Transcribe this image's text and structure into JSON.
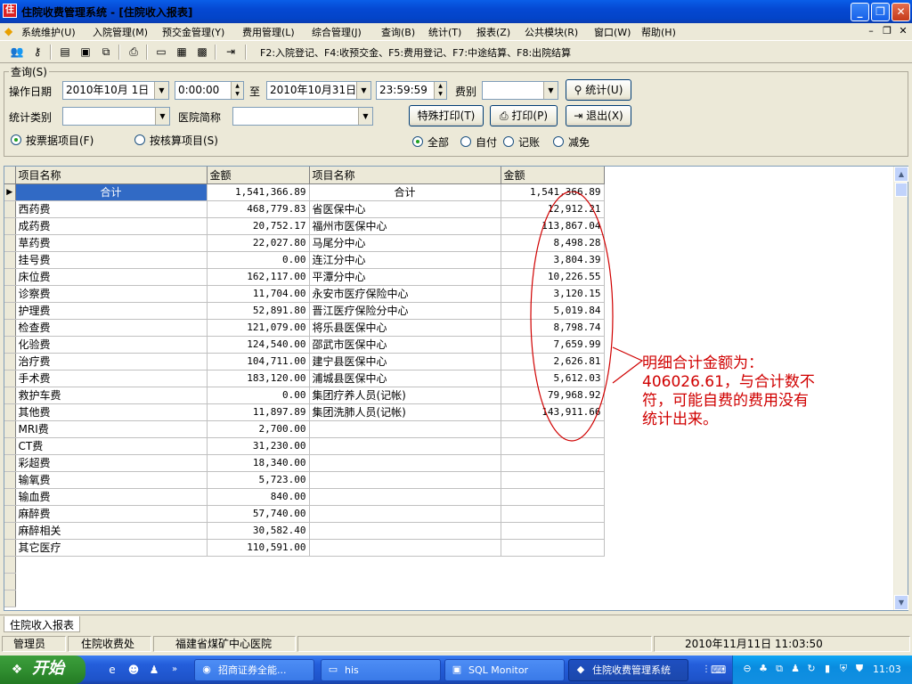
{
  "window": {
    "title": "住院收费管理系统 - [住院收入报表]",
    "app_icon": "住"
  },
  "menu": [
    "系统维护(U)",
    "入院管理(M)",
    "预交金管理(Y)",
    "费用管理(L)",
    "综合管理(J)",
    "查询(B)",
    "统计(T)",
    "报表(Z)",
    "公共模块(R)",
    "窗口(W)",
    "帮助(H)"
  ],
  "toolbar": {
    "hint": "F2:入院登记、F4:收预交金、F5:费用登记、F7:中途结算、F8:出院结算"
  },
  "query": {
    "legend": "查询(S)",
    "date_label": "操作日期",
    "date_from": "2010年10月 1日",
    "time_from": "0:00:00",
    "to_label": "至",
    "date_to": "2010年10月31日",
    "time_to": "23:59:59",
    "fee_type_label": "费别",
    "fee_type_value": "",
    "stat_button": "统计(U)",
    "stat_category_label": "统计类别",
    "stat_category_value": "",
    "hospital_label": "医院简称",
    "hospital_value": "",
    "special_print_button": "特殊打印(T)",
    "print_button": "打印(P)",
    "exit_button": "退出(X)",
    "by_receipt": "按票据项目(F)",
    "by_accounting": "按核算项目(S)",
    "opt_all": "全部",
    "opt_self": "自付",
    "opt_account": "记账",
    "opt_waive": "减免"
  },
  "grid": {
    "columns": [
      "项目名称",
      "金额",
      "项目名称",
      "金额"
    ],
    "rows": [
      [
        "合计",
        "1,541,366.89",
        "合计",
        "1,541,366.89"
      ],
      [
        "西药费",
        "468,779.83",
        "省医保中心",
        "12,912.21"
      ],
      [
        "成药费",
        "20,752.17",
        "福州市医保中心",
        "113,867.04"
      ],
      [
        "草药费",
        "22,027.80",
        "马尾分中心",
        "8,498.28"
      ],
      [
        "挂号费",
        "0.00",
        "连江分中心",
        "3,804.39"
      ],
      [
        "床位费",
        "162,117.00",
        "平潭分中心",
        "10,226.55"
      ],
      [
        "诊察费",
        "11,704.00",
        "永安市医疗保险中心",
        "3,120.15"
      ],
      [
        "护理费",
        "52,891.80",
        "晋江医疗保险分中心",
        "5,019.84"
      ],
      [
        "检查费",
        "121,079.00",
        "将乐县医保中心",
        "8,798.74"
      ],
      [
        "化验费",
        "124,540.00",
        "邵武市医保中心",
        "7,659.99"
      ],
      [
        "治疗费",
        "104,711.00",
        "建宁县医保中心",
        "2,626.81"
      ],
      [
        "手术费",
        "183,120.00",
        "浦城县医保中心",
        "5,612.03"
      ],
      [
        "救护车费",
        "0.00",
        "集团疗养人员(记帐)",
        "79,968.92"
      ],
      [
        "其他费",
        "11,897.89",
        "集团洗肺人员(记帐)",
        "143,911.66"
      ],
      [
        "MRI费",
        "2,700.00",
        "",
        ""
      ],
      [
        "CT费",
        "31,230.00",
        "",
        ""
      ],
      [
        "彩超费",
        "18,340.00",
        "",
        ""
      ],
      [
        "输氧费",
        "5,723.00",
        "",
        ""
      ],
      [
        "输血费",
        "840.00",
        "",
        ""
      ],
      [
        "麻醉费",
        "57,740.00",
        "",
        ""
      ],
      [
        "麻醉相关",
        "30,582.40",
        "",
        ""
      ],
      [
        "其它医疗",
        "110,591.00",
        "",
        ""
      ]
    ]
  },
  "annotation": {
    "text": "明细合计金额为：406026.61，与合计数不符，可能自费的费用没有统计出来。",
    "color": "#d00000"
  },
  "tabs": [
    "住院收入报表"
  ],
  "status": {
    "user": "管理员",
    "dept": "住院收费处",
    "hospital": "福建省煤矿中心医院",
    "blank": "",
    "datetime": "2010年11月11日  11:03:50"
  },
  "taskbar": {
    "start": "开始",
    "tasks": [
      "招商证券全能...",
      "his",
      "SQL Monitor",
      "住院收费管理系统"
    ],
    "clock": "11:03"
  }
}
